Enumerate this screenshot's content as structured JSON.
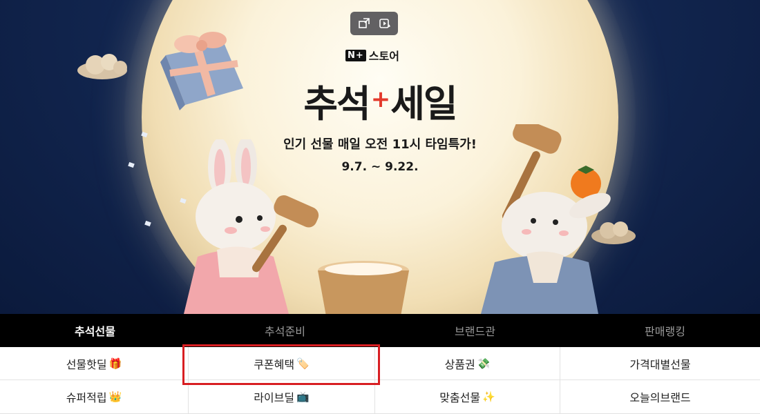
{
  "banner": {
    "brand_logo": "N+",
    "brand_name": "스토어",
    "title_left": "추석",
    "title_plus": "+",
    "title_right": "세일",
    "subtitle": "인기 선물 매일 오전 11시 타임특가!",
    "dates": "9.7. ~ 9.22.",
    "controls": [
      {
        "name": "pip-icon"
      },
      {
        "name": "video-settings-icon"
      }
    ]
  },
  "tabs": [
    {
      "label": "추석선물",
      "active": true
    },
    {
      "label": "추석준비",
      "active": false
    },
    {
      "label": "브랜드관",
      "active": false
    },
    {
      "label": "판매랭킹",
      "active": false
    }
  ],
  "grid": [
    {
      "label": "선물핫딜",
      "emoji": "🎁"
    },
    {
      "label": "쿠폰혜택",
      "emoji": "🏷️"
    },
    {
      "label": "상품권",
      "emoji": "💸"
    },
    {
      "label": "가격대별선물",
      "emoji": ""
    },
    {
      "label": "슈퍼적립",
      "emoji": "👑"
    },
    {
      "label": "라이브딜",
      "emoji": "📺"
    },
    {
      "label": "맞춤선물",
      "emoji": "✨"
    },
    {
      "label": "오늘의브랜드",
      "emoji": ""
    }
  ],
  "highlight_target": "쿠폰혜택",
  "colors": {
    "hero_background": "#122650",
    "moon": "#f6e8c6",
    "tab_bar": "#000000",
    "highlight": "#d81e22",
    "title_plus": "#e33a2c"
  }
}
